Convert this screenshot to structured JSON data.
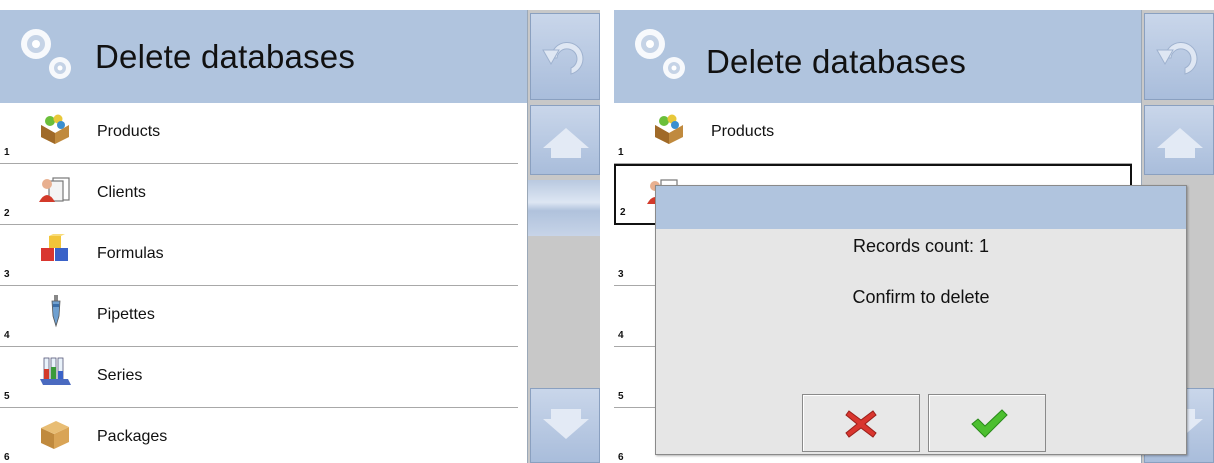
{
  "screen": {
    "title": "Delete databases",
    "header_color": "#b0c4de",
    "icons": {
      "header": "gears-icon",
      "back": "undo-arrow-icon",
      "scroll_up": "up-arrow-icon",
      "scroll_down": "down-arrow-icon"
    }
  },
  "list_left": [
    {
      "num": "1",
      "label": "Products",
      "icon": "products-box-icon"
    },
    {
      "num": "2",
      "label": "Clients",
      "icon": "clients-icon"
    },
    {
      "num": "3",
      "label": "Formulas",
      "icon": "formulas-cubes-icon"
    },
    {
      "num": "4",
      "label": "Pipettes",
      "icon": "pipette-icon"
    },
    {
      "num": "5",
      "label": "Series",
      "icon": "series-tubes-icon"
    },
    {
      "num": "6",
      "label": "Packages",
      "icon": "package-box-icon"
    }
  ],
  "list_right": [
    {
      "num": "1",
      "label": "Products"
    },
    {
      "num": "2",
      "label": ""
    },
    {
      "num": "3",
      "label": ""
    },
    {
      "num": "4",
      "label": ""
    },
    {
      "num": "5",
      "label": ""
    },
    {
      "num": "6",
      "label": ""
    }
  ],
  "dialog": {
    "records_text": "Records count: 1",
    "confirm_text": "Confirm to delete",
    "cancel_icon": "red-x-icon",
    "ok_icon": "green-check-icon"
  }
}
